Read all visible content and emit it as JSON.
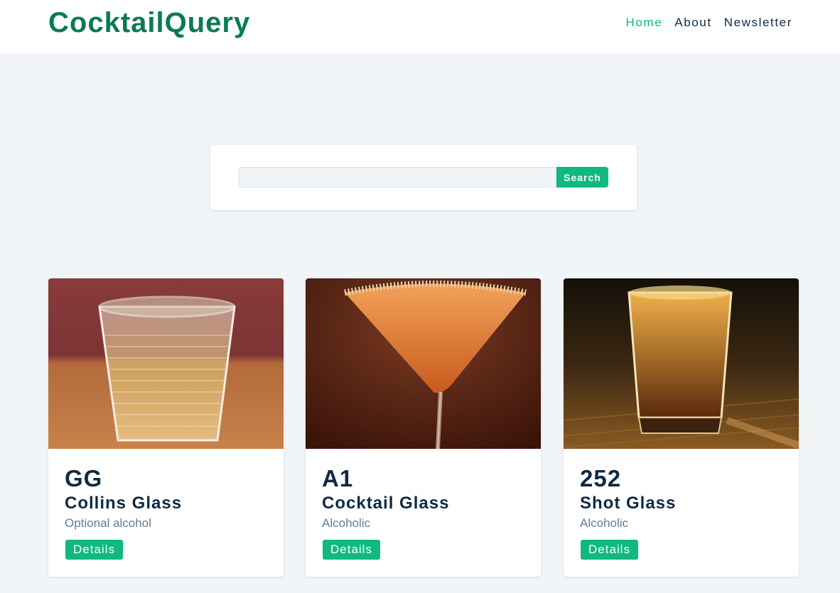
{
  "brand": {
    "title": "CocktailQuery"
  },
  "nav": {
    "items": [
      {
        "label": "Home",
        "active": true
      },
      {
        "label": "About",
        "active": false
      },
      {
        "label": "Newsletter",
        "active": false
      }
    ]
  },
  "search": {
    "placeholder": "",
    "value": "",
    "button_label": "Search"
  },
  "cocktails": [
    {
      "name": "GG",
      "glass": "Collins Glass",
      "info": "Optional alcohol",
      "button_label": "Details",
      "image_icon": "rocks-glass-photo"
    },
    {
      "name": "A1",
      "glass": "Cocktail Glass",
      "info": "Alcoholic",
      "button_label": "Details",
      "image_icon": "martini-glass-photo"
    },
    {
      "name": "252",
      "glass": "Shot Glass",
      "info": "Alcoholic",
      "button_label": "Details",
      "image_icon": "shot-glass-photo"
    }
  ],
  "colors": {
    "brand": "#0a7a55",
    "accent": "#10b981",
    "background": "#f1f5f8",
    "muted_text": "#617d98"
  }
}
